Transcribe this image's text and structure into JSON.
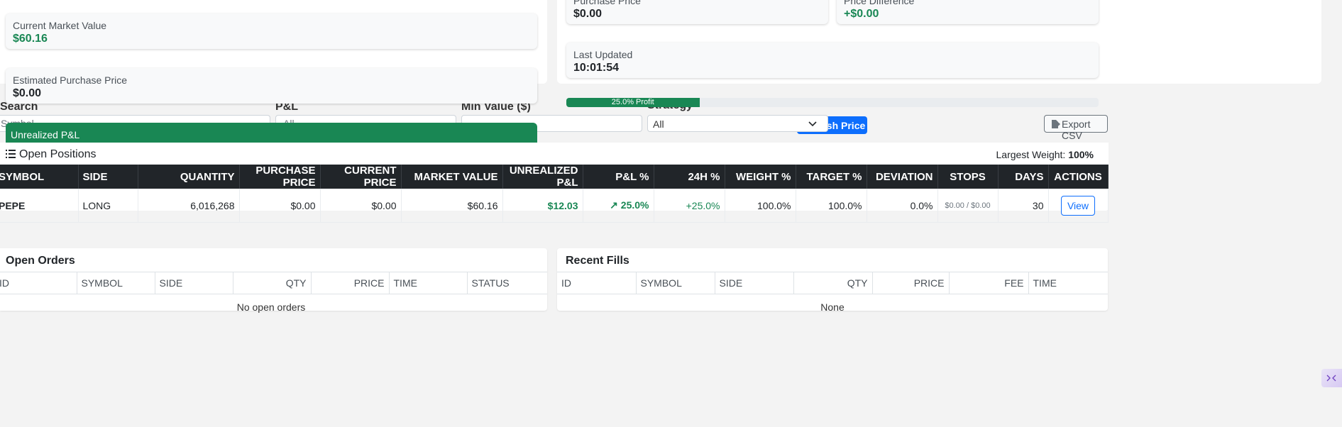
{
  "summary": {
    "current_market_value_label": "Current Market Value",
    "current_market_value": "$60.16",
    "estimated_purchase_price_label": "Estimated Purchase Price",
    "estimated_purchase_price": "$0.00",
    "purchase_price_label": "Purchase Price",
    "purchase_price": "$0.00",
    "price_difference_label": "Price Difference",
    "price_difference": "+$0.00",
    "last_updated_label": "Last Updated",
    "last_updated": "10:01:54",
    "unrealized_pnl_label": "Unrealized P&L",
    "profit_bar_label": "25.0% Profit",
    "profit_fraction": 0.25
  },
  "filters": {
    "search_label": "Search",
    "search_placeholder": "Symbol...",
    "pnl_label": "P&L",
    "pnl_selected": "All",
    "min_value_label": "Min Value ($)",
    "min_value": "",
    "strategy_label": "Strategy",
    "strategy_selected": "All",
    "refresh_button": "esh Price",
    "export_button": "Export CSV"
  },
  "positions": {
    "title": "Open Positions",
    "largest_weight_label": "Largest Weight:",
    "largest_weight_value": "100%",
    "columns": [
      "SYMBOL",
      "SIDE",
      "QUANTITY",
      "PURCHASE PRICE",
      "CURRENT PRICE",
      "MARKET VALUE",
      "UNREALIZED P&L",
      "P&L %",
      "24H %",
      "WEIGHT %",
      "TARGET %",
      "DEVIATION",
      "STOPS",
      "DAYS",
      "ACTIONS"
    ],
    "rows": [
      {
        "symbol": "PEPE",
        "side": "LONG",
        "quantity": "6,016,268",
        "purchase_price": "$0.00",
        "current_price": "$0.00",
        "market_value": "$60.16",
        "unrealized_pnl": "$12.03",
        "pnl_pct": "↗ 25.0%",
        "change_24h": "+25.0%",
        "weight": "100.0%",
        "target": "100.0%",
        "deviation": "0.0%",
        "stops": "$0.00 / $0.00",
        "days": "30",
        "action": "View"
      }
    ]
  },
  "open_orders": {
    "title": "Open Orders",
    "columns": [
      "ID",
      "SYMBOL",
      "SIDE",
      "QTY",
      "PRICE",
      "TIME",
      "STATUS"
    ],
    "empty_text": "No open orders"
  },
  "recent_fills": {
    "title": "Recent Fills",
    "columns": [
      "ID",
      "SYMBOL",
      "SIDE",
      "QTY",
      "PRICE",
      "FEE",
      "TIME"
    ],
    "empty_text": "None"
  },
  "colors": {
    "accent_green": "#198754",
    "primary_blue": "#0d6efd",
    "table_header": "#212529"
  }
}
